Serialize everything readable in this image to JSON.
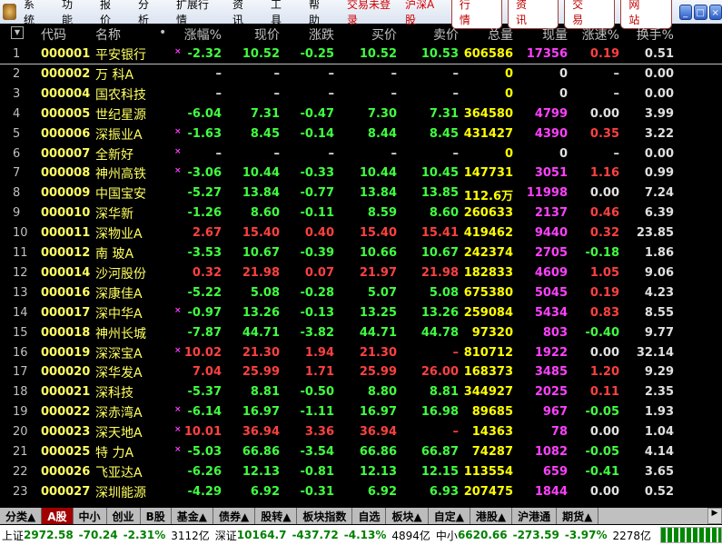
{
  "menubar": {
    "items": [
      "系统",
      "功能",
      "报价",
      "分析",
      "扩展行情",
      "资讯",
      "工具",
      "帮助"
    ],
    "login_status": "交易未登录",
    "market": "沪深A股",
    "buttons": [
      "行 情",
      "资 讯",
      "交 易",
      "网 站"
    ]
  },
  "header": {
    "columns": [
      "代码",
      "名称",
      "•",
      "涨幅%",
      "现价",
      "涨跌",
      "买价",
      "卖价",
      "总量",
      "现量",
      "涨速%",
      "换手%"
    ]
  },
  "colors": {
    "up": "#ff4040",
    "down": "#40ff40",
    "flat": "#e0e0e0",
    "code": "#ffff60",
    "volume": "#ffff00",
    "cur_volume": "#ff40ff"
  },
  "rows": [
    [
      "1",
      "000001",
      "平安银行",
      "×",
      "-2.32",
      "10.52",
      "-0.25",
      "10.52",
      "10.53",
      "606586",
      "17356",
      "0.19",
      "0.51"
    ],
    [
      "2",
      "000002",
      "万 科A",
      "",
      "–",
      "–",
      "–",
      "–",
      "–",
      "0",
      "0",
      "–",
      "0.00"
    ],
    [
      "3",
      "000004",
      "国农科技",
      "",
      "–",
      "–",
      "–",
      "–",
      "–",
      "0",
      "0",
      "–",
      "0.00"
    ],
    [
      "4",
      "000005",
      "世纪星源",
      "",
      "-6.04",
      "7.31",
      "-0.47",
      "7.30",
      "7.31",
      "364580",
      "4799",
      "0.00",
      "3.99"
    ],
    [
      "5",
      "000006",
      "深振业A",
      "×",
      "-1.63",
      "8.45",
      "-0.14",
      "8.44",
      "8.45",
      "431427",
      "4390",
      "0.35",
      "3.22"
    ],
    [
      "6",
      "000007",
      "全新好",
      "×",
      "–",
      "–",
      "–",
      "–",
      "–",
      "0",
      "0",
      "–",
      "0.00"
    ],
    [
      "7",
      "000008",
      "神州高铁",
      "×",
      "-3.06",
      "10.44",
      "-0.33",
      "10.44",
      "10.45",
      "147731",
      "3051",
      "1.16",
      "0.99"
    ],
    [
      "8",
      "000009",
      "中国宝安",
      "",
      "-5.27",
      "13.84",
      "-0.77",
      "13.84",
      "13.85",
      "112.6万",
      "11998",
      "0.00",
      "7.24"
    ],
    [
      "9",
      "000010",
      "深华新",
      "",
      "-1.26",
      "8.60",
      "-0.11",
      "8.59",
      "8.60",
      "260633",
      "2137",
      "0.46",
      "6.39"
    ],
    [
      "10",
      "000011",
      "深物业A",
      "",
      "2.67",
      "15.40",
      "0.40",
      "15.40",
      "15.41",
      "419462",
      "9440",
      "0.32",
      "23.85"
    ],
    [
      "11",
      "000012",
      "南 玻A",
      "",
      "-3.53",
      "10.67",
      "-0.39",
      "10.66",
      "10.67",
      "242374",
      "2705",
      "-0.18",
      "1.86"
    ],
    [
      "12",
      "000014",
      "沙河股份",
      "",
      "0.32",
      "21.98",
      "0.07",
      "21.97",
      "21.98",
      "182833",
      "4609",
      "1.05",
      "9.06"
    ],
    [
      "13",
      "000016",
      "深康佳A",
      "",
      "-5.22",
      "5.08",
      "-0.28",
      "5.07",
      "5.08",
      "675380",
      "5045",
      "0.19",
      "4.23"
    ],
    [
      "14",
      "000017",
      "深中华A",
      "×",
      "-0.97",
      "13.26",
      "-0.13",
      "13.25",
      "13.26",
      "259084",
      "5434",
      "0.83",
      "8.55"
    ],
    [
      "15",
      "000018",
      "神州长城",
      "",
      "-7.87",
      "44.71",
      "-3.82",
      "44.71",
      "44.78",
      "97320",
      "803",
      "-0.40",
      "9.77"
    ],
    [
      "16",
      "000019",
      "深深宝A",
      "×",
      "10.02",
      "21.30",
      "1.94",
      "21.30",
      "–",
      "810712",
      "1922",
      "0.00",
      "32.14"
    ],
    [
      "17",
      "000020",
      "深华发A",
      "",
      "7.04",
      "25.99",
      "1.71",
      "25.99",
      "26.00",
      "168373",
      "3485",
      "1.20",
      "9.29"
    ],
    [
      "18",
      "000021",
      "深科技",
      "",
      "-5.37",
      "8.81",
      "-0.50",
      "8.80",
      "8.81",
      "344927",
      "2025",
      "0.11",
      "2.35"
    ],
    [
      "19",
      "000022",
      "深赤湾A",
      "×",
      "-6.14",
      "16.97",
      "-1.11",
      "16.97",
      "16.98",
      "89685",
      "967",
      "-0.05",
      "1.93"
    ],
    [
      "20",
      "000023",
      "深天地A",
      "×",
      "10.01",
      "36.94",
      "3.36",
      "36.94",
      "–",
      "14363",
      "78",
      "0.00",
      "1.04"
    ],
    [
      "21",
      "000025",
      "特 力A",
      "×",
      "-5.03",
      "66.86",
      "-3.54",
      "66.86",
      "66.87",
      "74287",
      "1082",
      "-0.05",
      "4.14"
    ],
    [
      "22",
      "000026",
      "飞亚达A",
      "",
      "-6.26",
      "12.13",
      "-0.81",
      "12.13",
      "12.15",
      "113554",
      "659",
      "-0.41",
      "3.65"
    ],
    [
      "23",
      "000027",
      "深圳能源",
      "",
      "-4.29",
      "6.92",
      "-0.31",
      "6.92",
      "6.93",
      "207475",
      "1844",
      "0.00",
      "0.52"
    ]
  ],
  "tabs": [
    "分类▲",
    "A股",
    "中小",
    "创业",
    "B股",
    "基金▲",
    "债券▲",
    "股转▲",
    "板块指数",
    "自选",
    "板块▲",
    "自定▲",
    "港股▲",
    "沪港通",
    "期货▲"
  ],
  "status": {
    "sh_label": "上证",
    "sh": "2972.58",
    "sh_chg": "-70.24",
    "sh_pct": "-2.31%",
    "sh_amt": "3112亿",
    "sz_label": "深证",
    "sz": "10164.7",
    "sz_chg": "-437.72",
    "sz_pct": "-4.13%",
    "sz_amt": "4894亿",
    "zx_label": "中小",
    "zx": "6620.66",
    "zx_chg": "-273.59",
    "zx_pct": "-3.97%",
    "zx_amt": "2278亿"
  }
}
